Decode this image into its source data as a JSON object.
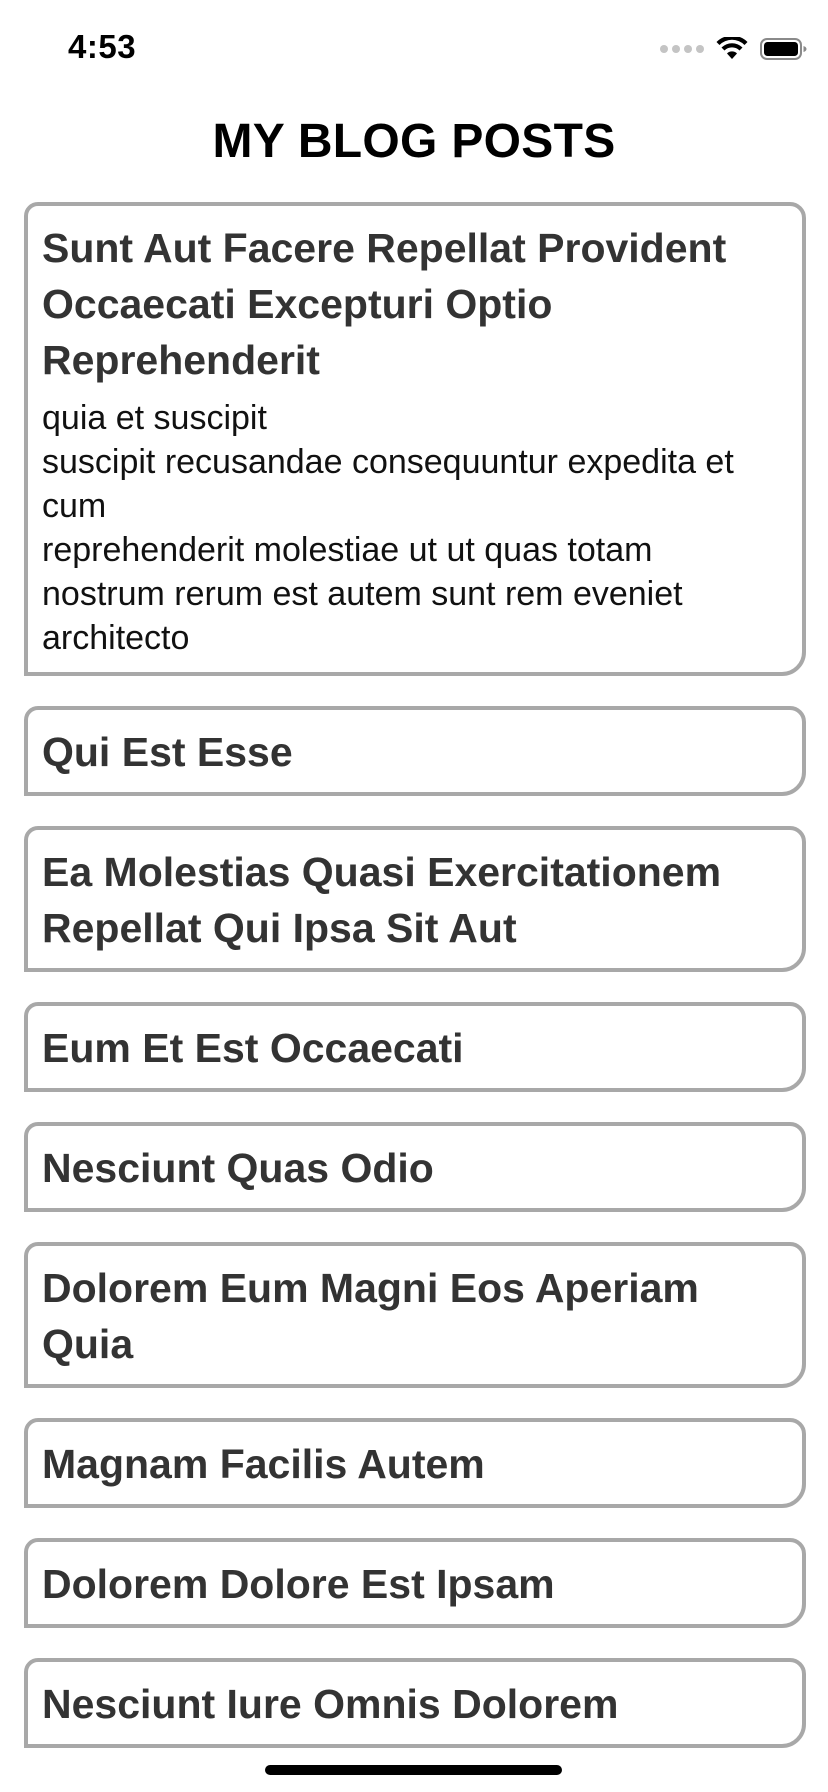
{
  "status_bar": {
    "time": "4:53",
    "icons": [
      "signal-icon",
      "wifi-icon",
      "battery-icon"
    ]
  },
  "header": {
    "title": "MY BLOG POSTS"
  },
  "posts": [
    {
      "title": "Sunt Aut Facere Repellat Provident Occaecati Excepturi Optio Reprehenderit",
      "body": "quia et suscipit\nsuscipit recusandae consequuntur expedita et cum\nreprehenderit molestiae ut ut quas totam\nnostrum rerum est autem sunt rem eveniet architecto"
    },
    {
      "title": "Qui Est Esse"
    },
    {
      "title": "Ea Molestias Quasi Exercitationem Repellat Qui Ipsa Sit Aut"
    },
    {
      "title": "Eum Et Est Occaecati"
    },
    {
      "title": "Nesciunt Quas Odio"
    },
    {
      "title": "Dolorem Eum Magni Eos Aperiam Quia"
    },
    {
      "title": "Magnam Facilis Autem"
    },
    {
      "title": "Dolorem Dolore Est Ipsam"
    },
    {
      "title": "Nesciunt Iure Omnis Dolorem"
    }
  ],
  "colors": {
    "card_border": "#a8a8a8",
    "title_text": "#333333",
    "background": "#ffffff"
  }
}
